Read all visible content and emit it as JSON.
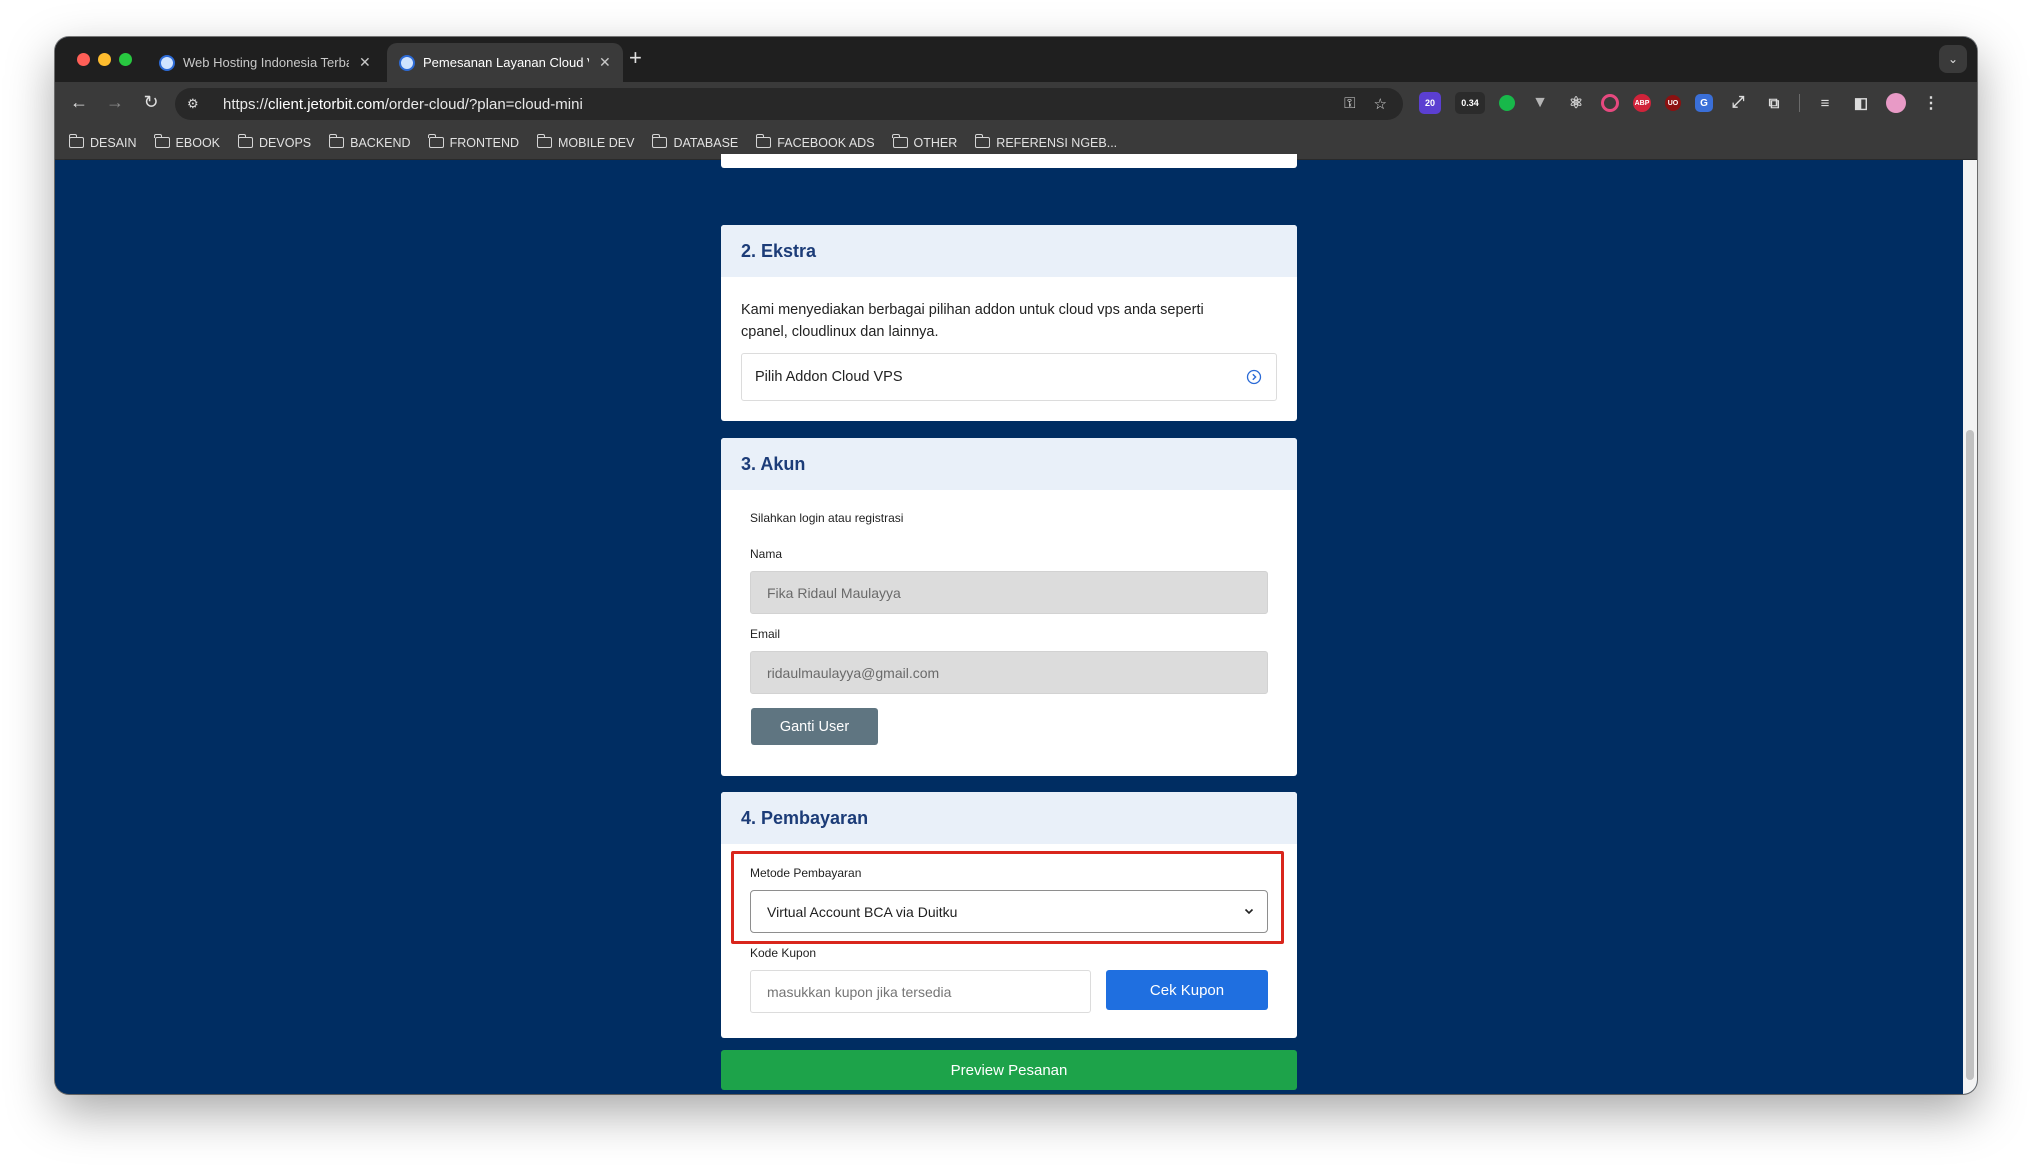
{
  "browser": {
    "tabs": [
      {
        "title": "Web Hosting Indonesia Terbaik",
        "active": false
      },
      {
        "title": "Pemesanan Layanan Cloud VPS",
        "active": true
      }
    ],
    "new_tab_icon": "plus-icon",
    "url": "https://client.jetorbit.com/order-cloud/?plan=cloud-mini",
    "url_parts": {
      "prefix": "https://",
      "host": "client.jetorbit.com",
      "path": "/order-cloud/?plan=cloud-mini"
    },
    "extensions": [
      {
        "name": "extension-20-icon",
        "label": "20",
        "color": "#5b3fd1"
      },
      {
        "name": "extension-034-icon",
        "label": "0.34",
        "color": "#2b2b2b"
      },
      {
        "name": "extension-green-dot-icon",
        "label": "",
        "color": "#18b84a"
      },
      {
        "name": "vue-devtools-icon",
        "label": "",
        "color": "#8a8a8a"
      },
      {
        "name": "react-devtools-icon",
        "label": "",
        "color": "#7ac7e6"
      },
      {
        "name": "color-picker-icon",
        "label": "",
        "color": "#e6497f"
      },
      {
        "name": "adblock-plus-icon",
        "label": "ABP",
        "color": "#d0233a"
      },
      {
        "name": "ublock-icon",
        "label": "UO",
        "color": "#8b1111"
      },
      {
        "name": "translate-icon",
        "label": "G",
        "color": "#3a6fd8"
      }
    ],
    "bookmarks": [
      "DESAIN",
      "EBOOK",
      "DEVOPS",
      "BACKEND",
      "FRONTEND",
      "MOBILE DEV",
      "DATABASE",
      "FACEBOOK ADS",
      "OTHER",
      "REFERENSI NGEB..."
    ]
  },
  "ekstra": {
    "title": "2. Ekstra",
    "description": "Kami menyediakan berbagai pilihan addon untuk cloud vps anda seperti cpanel, cloudlinux dan lainnya.",
    "addon_button": "Pilih Addon Cloud VPS"
  },
  "akun": {
    "title": "3. Akun",
    "instruction": "Silahkan login atau registrasi",
    "name_label": "Nama",
    "name_value": "Fika Ridaul Maulayya",
    "email_label": "Email",
    "email_value": "ridaulmaulayya@gmail.com",
    "change_user_button": "Ganti User"
  },
  "pembayaran": {
    "title": "4. Pembayaran",
    "method_label": "Metode Pembayaran",
    "method_value": "Virtual Account BCA via Duitku",
    "coupon_label": "Kode Kupon",
    "coupon_placeholder": "masukkan kupon jika tersedia",
    "coupon_button": "Cek Kupon"
  },
  "preview_button": "Preview Pesanan",
  "colors": {
    "page_bg": "#002d62",
    "card_header": "#e9f0f9",
    "heading": "#1c3c78",
    "primary_button": "#1f6fe0",
    "secondary_button": "#5f7581",
    "success_button": "#1da34a",
    "highlight": "#d9261c"
  }
}
